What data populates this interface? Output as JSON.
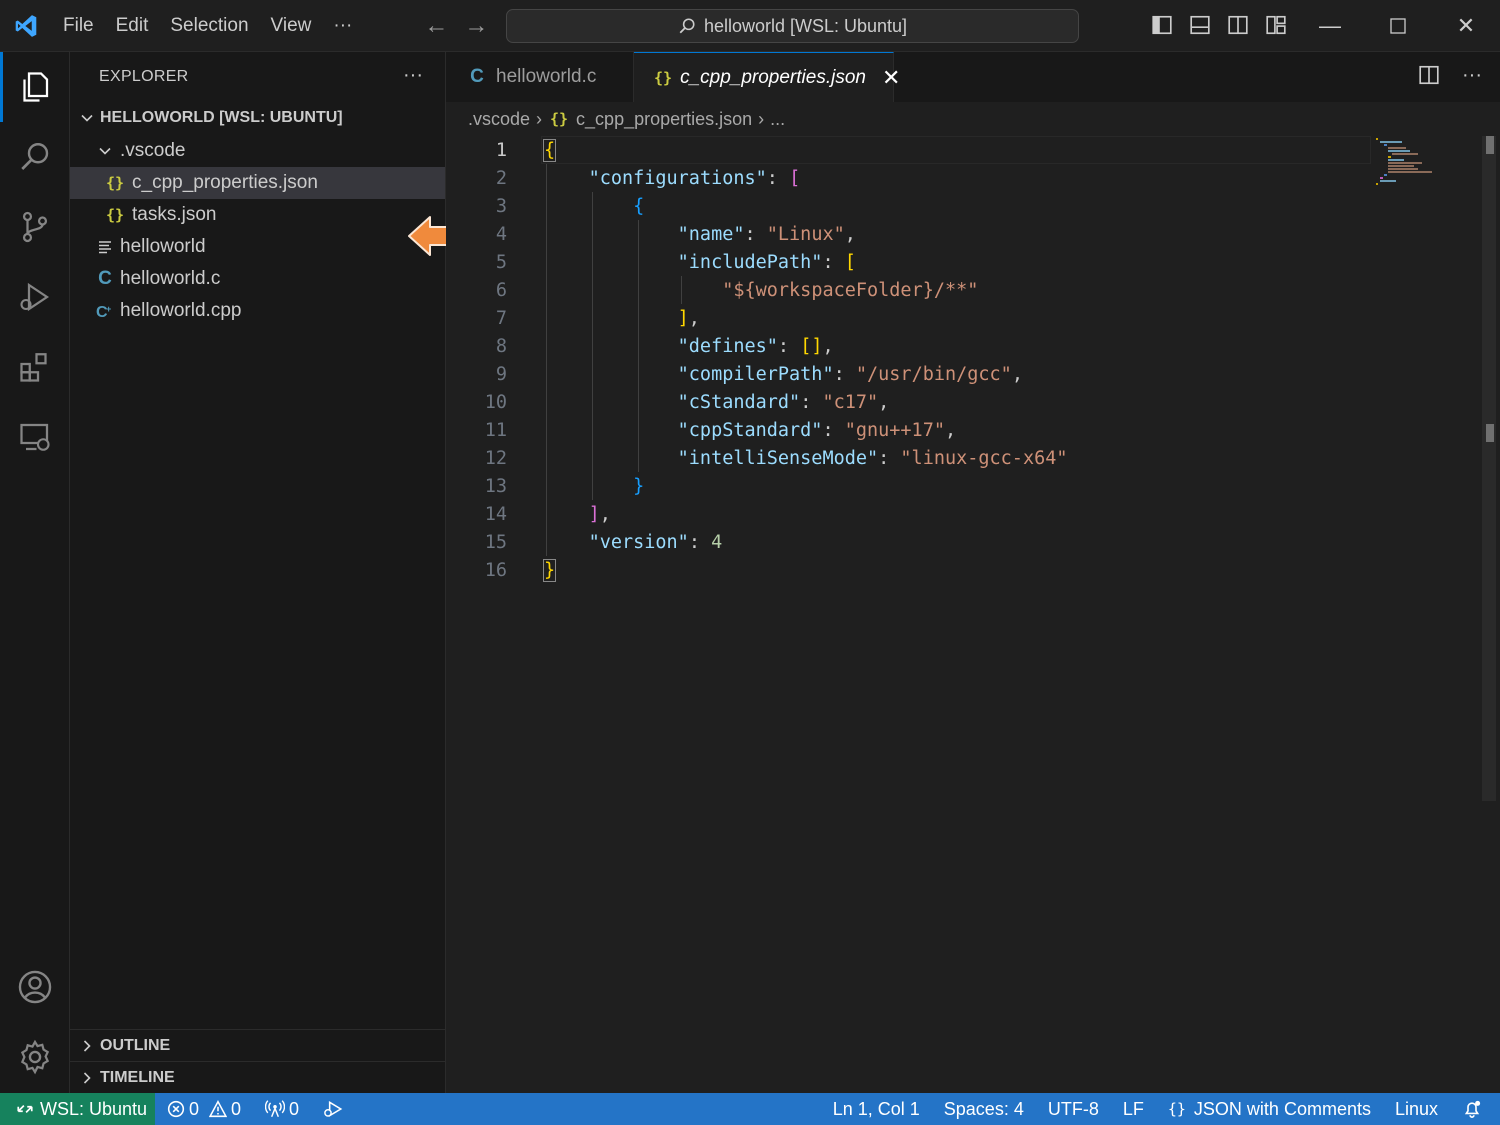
{
  "menu": [
    "File",
    "Edit",
    "Selection",
    "View",
    "···"
  ],
  "command_center": {
    "label": "helloworld [WSL: Ubuntu]"
  },
  "explorer": {
    "title": "EXPLORER",
    "more": "···",
    "workspace": "HELLOWORLD [WSL: UBUNTU]",
    "items": [
      {
        "label": ".vscode",
        "kind": "folder",
        "expanded": true
      },
      {
        "label": "c_cpp_properties.json",
        "kind": "json",
        "selected": true
      },
      {
        "label": "tasks.json",
        "kind": "json"
      },
      {
        "label": "helloworld",
        "kind": "binary"
      },
      {
        "label": "helloworld.c",
        "kind": "c"
      },
      {
        "label": "helloworld.cpp",
        "kind": "cpp"
      }
    ],
    "json_glyph": "{}",
    "sections": [
      "OUTLINE",
      "TIMELINE"
    ]
  },
  "tabs": [
    {
      "label": "helloworld.c",
      "icon": "C",
      "active": false
    },
    {
      "label": "c_cpp_properties.json",
      "icon": "{}",
      "active": true,
      "close": "✕"
    }
  ],
  "breadcrumb": {
    "folder": ".vscode",
    "file": "c_cpp_properties.json",
    "more": "..."
  },
  "editor": {
    "lines": [
      {
        "n": "1"
      },
      {
        "n": "2"
      },
      {
        "n": "3"
      },
      {
        "n": "4"
      },
      {
        "n": "5"
      },
      {
        "n": "6"
      },
      {
        "n": "7"
      },
      {
        "n": "8"
      },
      {
        "n": "9"
      },
      {
        "n": "10"
      },
      {
        "n": "11"
      },
      {
        "n": "12"
      },
      {
        "n": "13"
      },
      {
        "n": "14"
      },
      {
        "n": "15"
      },
      {
        "n": "16"
      }
    ],
    "tokens": {
      "configurations": "\"configurations\"",
      "name_key": "\"name\"",
      "name_val": "\"Linux\"",
      "include_key": "\"includePath\"",
      "include_val": "\"${workspaceFolder}/**\"",
      "defines_key": "\"defines\"",
      "compiler_key": "\"compilerPath\"",
      "compiler_val": "\"/usr/bin/gcc\"",
      "cstd_key": "\"cStandard\"",
      "cstd_val": "\"c17\"",
      "cppstd_key": "\"cppStandard\"",
      "cppstd_val": "\"gnu++17\"",
      "intelli_key": "\"intelliSenseMode\"",
      "intelli_val": "\"linux-gcc-x64\"",
      "version_key": "\"version\"",
      "version_val": "4"
    }
  },
  "statusbar": {
    "remote": "WSL: Ubuntu",
    "errors": "0",
    "warnings": "0",
    "ports": "0",
    "position": "Ln 1, Col 1",
    "spaces": "Spaces: 4",
    "encoding": "UTF-8",
    "eol": "LF",
    "language": "JSON with Comments",
    "platform": "Linux"
  },
  "colors": {
    "accent": "#0078d4",
    "statusbar": "#2474c7",
    "remote": "#16825d",
    "callout_arrow": "#f08a3c"
  }
}
